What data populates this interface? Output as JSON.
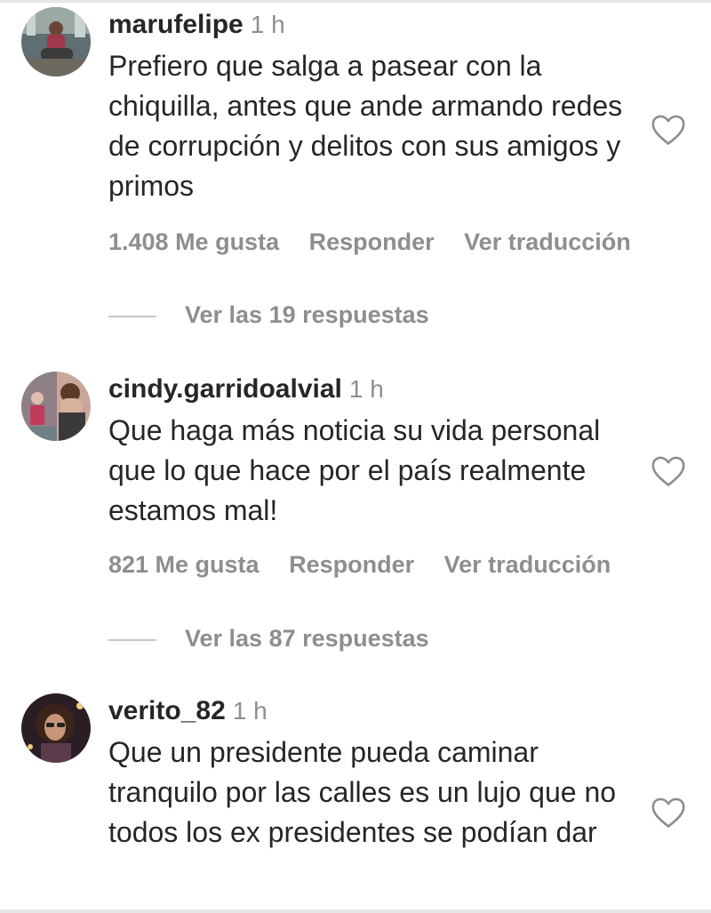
{
  "comments": [
    {
      "username": "marufelipe",
      "time": "1 h",
      "text": "Prefiero que salga a pasear con la chiquilla, antes que ande armando redes de corrupción y delitos con sus amigos y primos",
      "likes": "1.408 Me gusta",
      "reply": "Responder",
      "translate": "Ver traducción",
      "view_replies": "Ver las 19 respuestas",
      "avatar_icon": "avatar-photo-icon"
    },
    {
      "username": "cindy.garridoalvial",
      "time": "1 h",
      "text": "Que haga más noticia su vida personal que lo que hace por el país realmente estamos mal!",
      "likes": "821 Me gusta",
      "reply": "Responder",
      "translate": "Ver traducción",
      "view_replies": "Ver las 87 respuestas",
      "avatar_icon": "avatar-photo-icon"
    },
    {
      "username": "verito_82",
      "time": "1 h",
      "text": "Que un presidente pueda caminar tranquilo por las calles es un lujo que no todos los ex presidentes se podían dar",
      "avatar_icon": "avatar-photo-icon"
    }
  ],
  "colors": {
    "text": "#262626",
    "secondary": "#8e8e8e",
    "divider": "#c7c7c7"
  },
  "icons": {
    "like": "heart-outline-icon"
  }
}
